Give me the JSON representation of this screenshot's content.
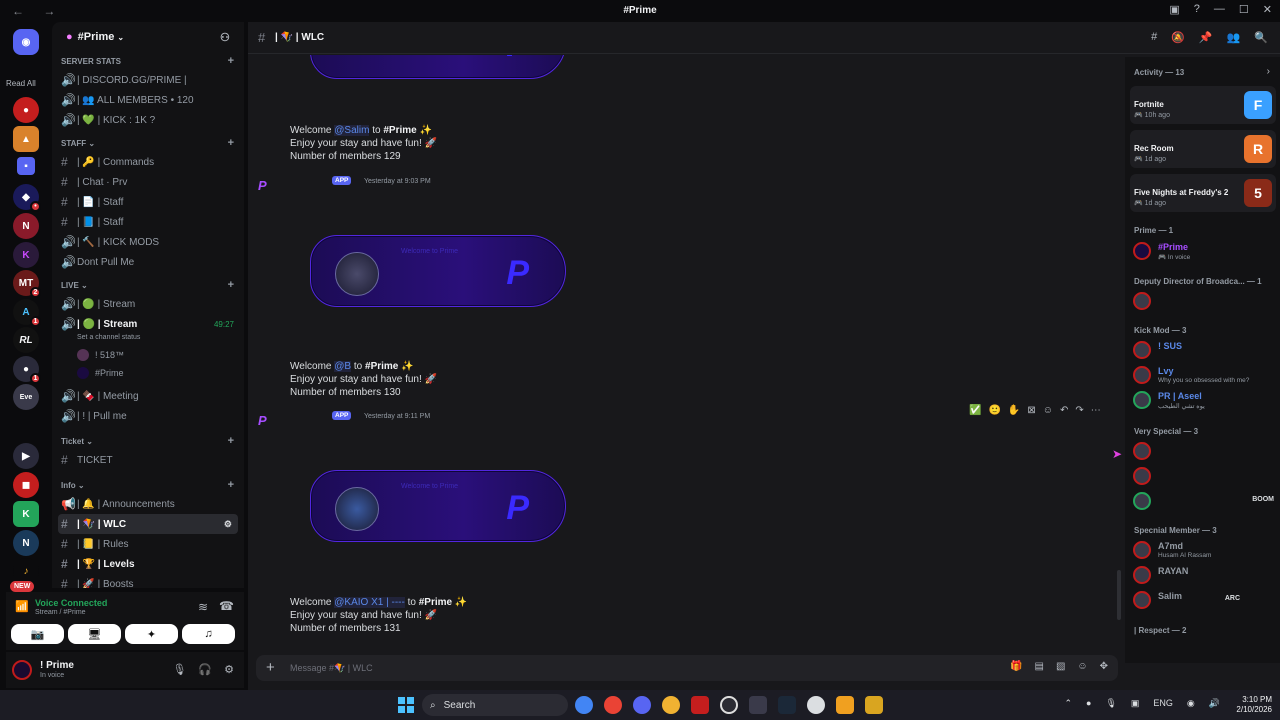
{
  "window": {
    "title": "#Prime",
    "nav": "← →"
  },
  "servers": {
    "read_all": "Read All",
    "new_tag": "NEW"
  },
  "guild": {
    "name": "#Prime"
  },
  "channels": {
    "server_stats_label": "SERVER STATS",
    "stats": [
      "| DISCORD.GG/PRIME |",
      "| 👥 ALL MEMBERS • 120",
      "| 💚 | KICK : 1K ?"
    ],
    "staff_label": "Staff",
    "staff": [
      "| 🔑 | Commands",
      "| Chat · Prv",
      "| 📄 | Staff",
      "| 📘 | Staff",
      "| 🔨 | KICK MODS",
      "Dont Pull Me"
    ],
    "live_label": "LIVE",
    "live": [
      "| 🟢 | Stream",
      "| 🟢 | Stream"
    ],
    "stream_timer": "49:27",
    "channel_status": "Set a channel status",
    "voice_users": [
      "! 518™",
      "#Prime"
    ],
    "meeting": [
      "| 🍫 | Meeting",
      "| ! | Pull me"
    ],
    "ticket_label": "Ticket",
    "ticket": "TICKET",
    "info_label": "Info",
    "info": [
      "| 🔔 | Announcements",
      "| 🪁 | WLC",
      "| 📒 | Rules",
      "| 🏆 | Levels",
      "| 🚀 | Boosts"
    ]
  },
  "voice": {
    "connected": "Voice Connected",
    "channel": "Stream / #Prime"
  },
  "user": {
    "name": "! Prime",
    "status": "In voice"
  },
  "header": {
    "channel": "| 🪁 | WLC"
  },
  "messages": [
    {
      "welcome_prefix": "Welcome",
      "mention": "@Salim",
      "to": "to",
      "server": "#Prime",
      "line2": "Enjoy your stay and have fun! 🚀",
      "line3": "Number of members 129"
    },
    {
      "app": "APP",
      "time": "Yesterday at 9:03 PM",
      "welcome_prefix": "Welcome",
      "mention": "@B",
      "to": "to",
      "server": "#Prime",
      "line2": "Enjoy your stay and have fun! 🚀",
      "line3": "Number of members 130"
    },
    {
      "app": "APP",
      "time": "Yesterday at 9:11 PM",
      "welcome_prefix": "Welcome",
      "mention": "@KAIO X1 | ----",
      "to": "to",
      "server": "#Prime",
      "line2": "Enjoy your stay and have fun! 🚀",
      "line3": "Number of members 131"
    }
  ],
  "banner": {
    "text": "Welcome to Prime"
  },
  "composer": {
    "placeholder": "Message #🪁 | WLC"
  },
  "activity": {
    "header": "Activity — 13",
    "cards": [
      {
        "game": "Fortnite",
        "time": "🎮 10h ago",
        "icon": "F",
        "color": "#3aa0ff"
      },
      {
        "game": "Rec Room",
        "time": "🎮 1d ago",
        "icon": "R",
        "color": "#e8732d"
      },
      {
        "game": "Five Nights at Freddy's 2",
        "time": "🎮 1d ago",
        "icon": "5",
        "color": "#8a2a18"
      }
    ]
  },
  "members": {
    "roles": [
      "Prime — 1",
      "Deputy Director of Broadca... — 1",
      "Kick Mod — 3",
      "Very Special — 3",
      "Specnial Member — 3",
      "| Respect — 2"
    ],
    "list": [
      {
        "name": "#Prime",
        "sub": "🎮 In voice",
        "color": "#a64dff",
        "right": ""
      },
      {
        "name": "",
        "sub": "",
        "color": "#dbdee1",
        "right": ""
      },
      {
        "name": "! SUS",
        "sub": "",
        "color": "#5a88e8",
        "right": ""
      },
      {
        "name": "Lvy",
        "sub": "Why you so obsessed with me?",
        "color": "#5a88e8",
        "right": ""
      },
      {
        "name": "PR | Aseel",
        "sub": "يوه تشي الطيحب",
        "color": "#5a88e8",
        "right": ""
      },
      {
        "name": "",
        "sub": "",
        "color": "#dbdee1",
        "right": ""
      },
      {
        "name": "",
        "sub": "",
        "color": "#dbdee1",
        "right": ""
      },
      {
        "name": "",
        "sub": "",
        "color": "#dbdee1",
        "right": "BOOM"
      },
      {
        "name": "A7md",
        "sub": "Husam Al Rassam",
        "color": "#949ba4",
        "right": ""
      },
      {
        "name": "RAYAN",
        "sub": "",
        "color": "#949ba4",
        "right": ""
      },
      {
        "name": "Salim",
        "sub": "",
        "color": "#949ba4",
        "right": "ARC"
      }
    ]
  },
  "taskbar": {
    "search": "Search",
    "lang": "ENG",
    "time": "3:10 PM",
    "date": "2/10/2026"
  }
}
